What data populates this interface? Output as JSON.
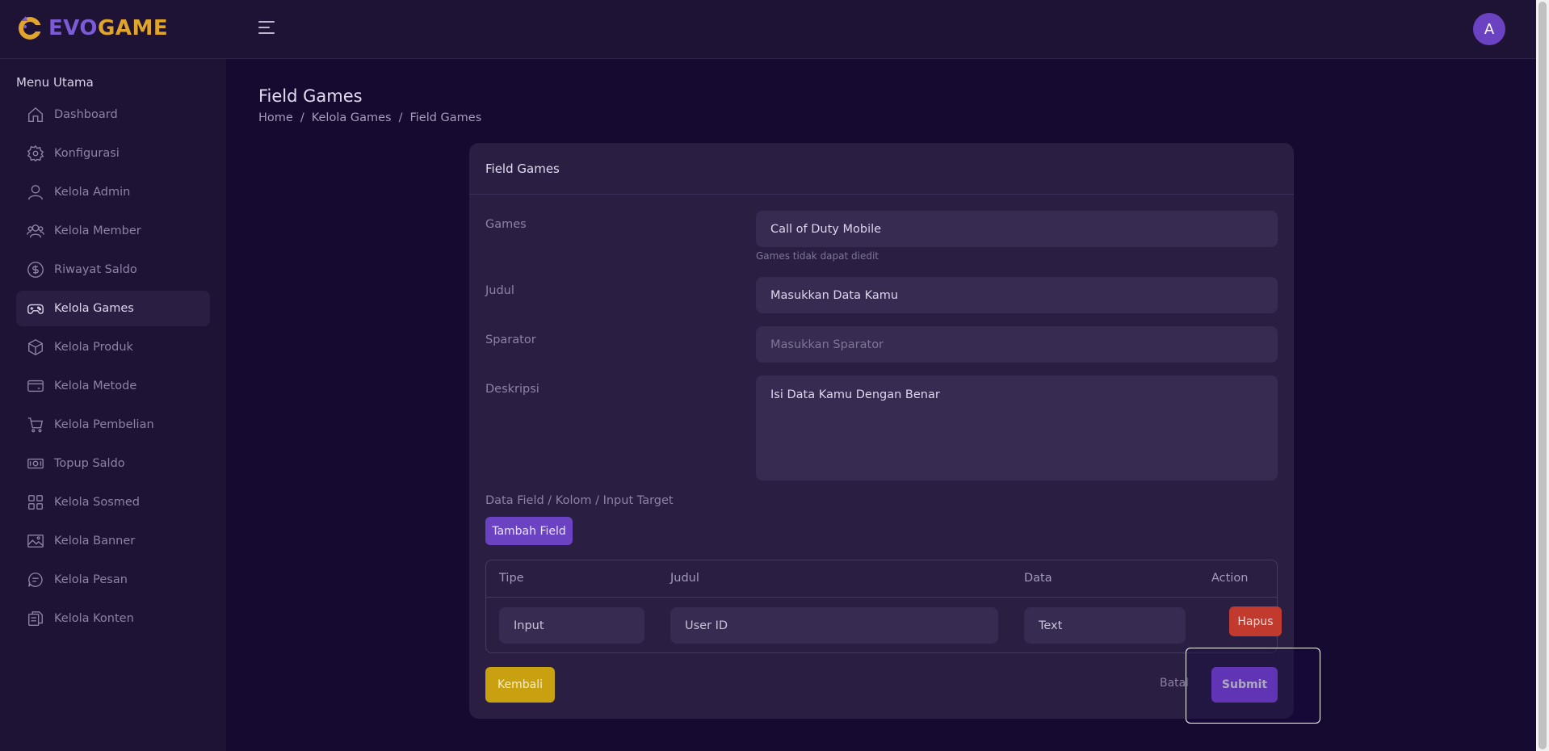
{
  "header": {
    "logo_part1": "EVO",
    "logo_part2": "GAME",
    "avatar_initial": "A"
  },
  "sidebar": {
    "title": "Menu Utama",
    "items": [
      {
        "label": "Dashboard",
        "icon": "home-icon"
      },
      {
        "label": "Konfigurasi",
        "icon": "gear-icon"
      },
      {
        "label": "Kelola Admin",
        "icon": "user-icon"
      },
      {
        "label": "Kelola Member",
        "icon": "users-icon"
      },
      {
        "label": "Riwayat Saldo",
        "icon": "dollar-circle-icon"
      },
      {
        "label": "Kelola Games",
        "icon": "gamepad-icon",
        "active": true
      },
      {
        "label": "Kelola Produk",
        "icon": "box-icon"
      },
      {
        "label": "Kelola Metode",
        "icon": "credit-card-icon"
      },
      {
        "label": "Kelola Pembelian",
        "icon": "cart-icon"
      },
      {
        "label": "Topup Saldo",
        "icon": "cash-icon"
      },
      {
        "label": "Kelola Sosmed",
        "icon": "grid-icon"
      },
      {
        "label": "Kelola Banner",
        "icon": "image-icon"
      },
      {
        "label": "Kelola Pesan",
        "icon": "chat-icon"
      },
      {
        "label": "Kelola Konten",
        "icon": "files-icon"
      }
    ]
  },
  "page": {
    "title": "Field Games",
    "breadcrumb": [
      "Home",
      "Kelola Games",
      "Field Games"
    ]
  },
  "form": {
    "card_title": "Field Games",
    "games_label": "Games",
    "games_value": "Call of Duty Mobile",
    "games_help": "Games tidak dapat diedit",
    "judul_label": "Judul",
    "judul_value": "Masukkan Data Kamu",
    "sparator_label": "Sparator",
    "sparator_placeholder": "Masukkan Sparator",
    "deskripsi_label": "Deskripsi",
    "deskripsi_value": "Isi Data Kamu Dengan Benar",
    "data_field_label": "Data Field / Kolom / Input Target",
    "add_field_button": "Tambah Field",
    "table": {
      "columns": [
        "Tipe",
        "Judul",
        "Data",
        "Action"
      ],
      "rows": [
        {
          "tipe": "Input",
          "judul": "User ID",
          "data": "Text",
          "action": "Hapus"
        }
      ]
    },
    "back_button": "Kembali",
    "cancel_button": "Batal",
    "submit_button": "Submit"
  },
  "colors": {
    "accent": "#8a4cf2",
    "danger": "#c23a2e",
    "warning": "#c9a00f",
    "logo_evo": "#7b5bd6",
    "logo_game": "#e0a52a"
  }
}
